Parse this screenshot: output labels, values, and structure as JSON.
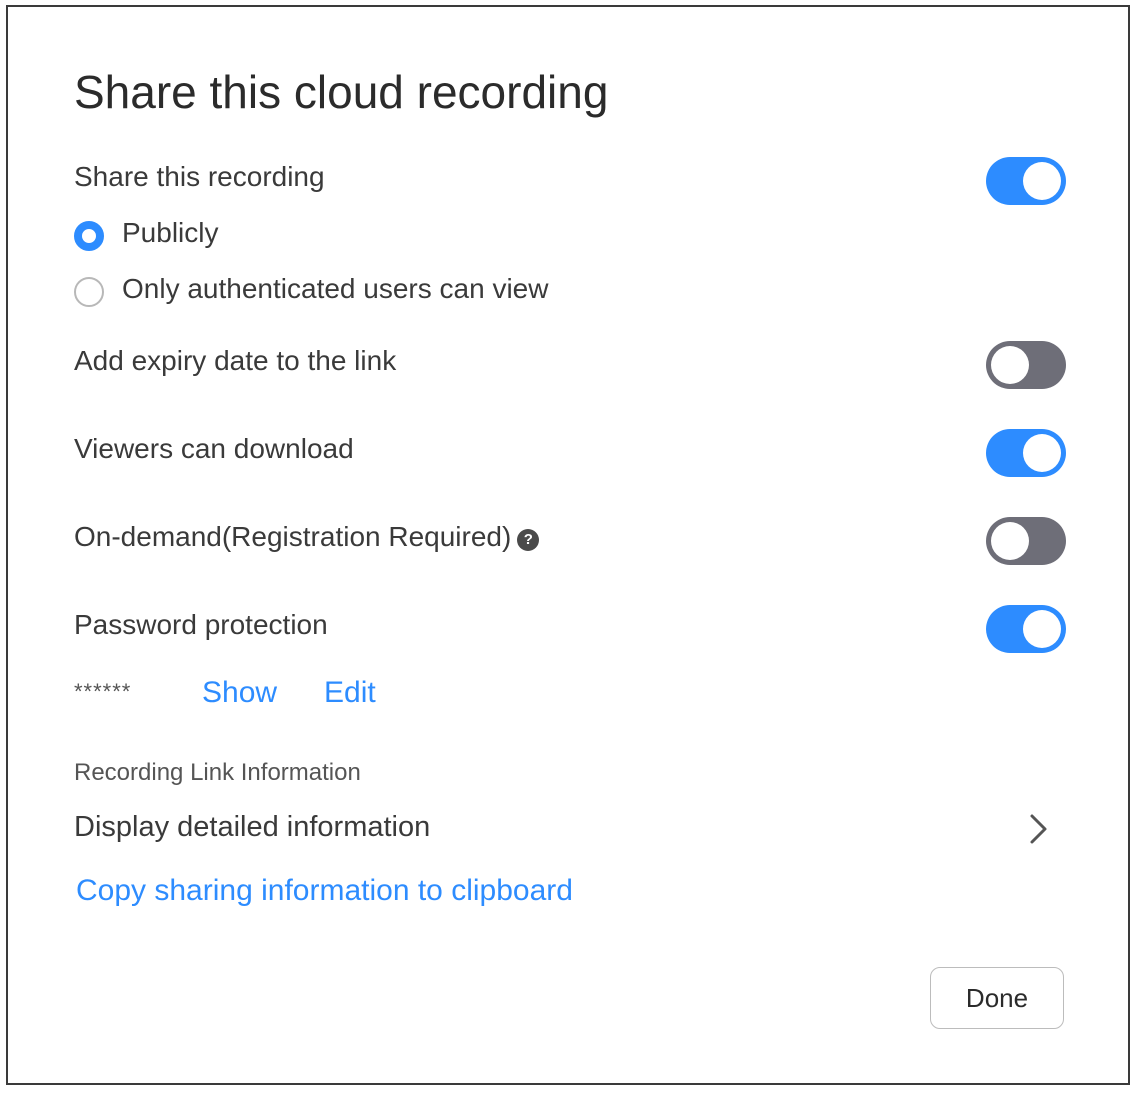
{
  "dialog": {
    "title": "Share this cloud recording"
  },
  "share": {
    "label": "Share this recording",
    "enabled": true,
    "options": [
      {
        "label": "Publicly",
        "selected": true
      },
      {
        "label": "Only authenticated users can view",
        "selected": false
      }
    ]
  },
  "expiry": {
    "label": "Add expiry date to the link",
    "enabled": false
  },
  "download": {
    "label": "Viewers can download",
    "enabled": true
  },
  "ondemand": {
    "label": "On-demand(Registration Required)",
    "help_icon": "question-circle-icon",
    "enabled": false
  },
  "password": {
    "label": "Password protection",
    "enabled": true,
    "masked_value": "******",
    "show_label": "Show",
    "edit_label": "Edit"
  },
  "link_info": {
    "section_label": "Recording Link Information",
    "detail_label": "Display detailed information",
    "chevron_icon": "chevron-right-icon",
    "copy_label": "Copy sharing information to clipboard"
  },
  "footer": {
    "done_label": "Done"
  },
  "colors": {
    "accent": "#2d8cff",
    "toggle_off": "#6e6e78",
    "text": "#333333",
    "border": "#3a3a3a"
  }
}
